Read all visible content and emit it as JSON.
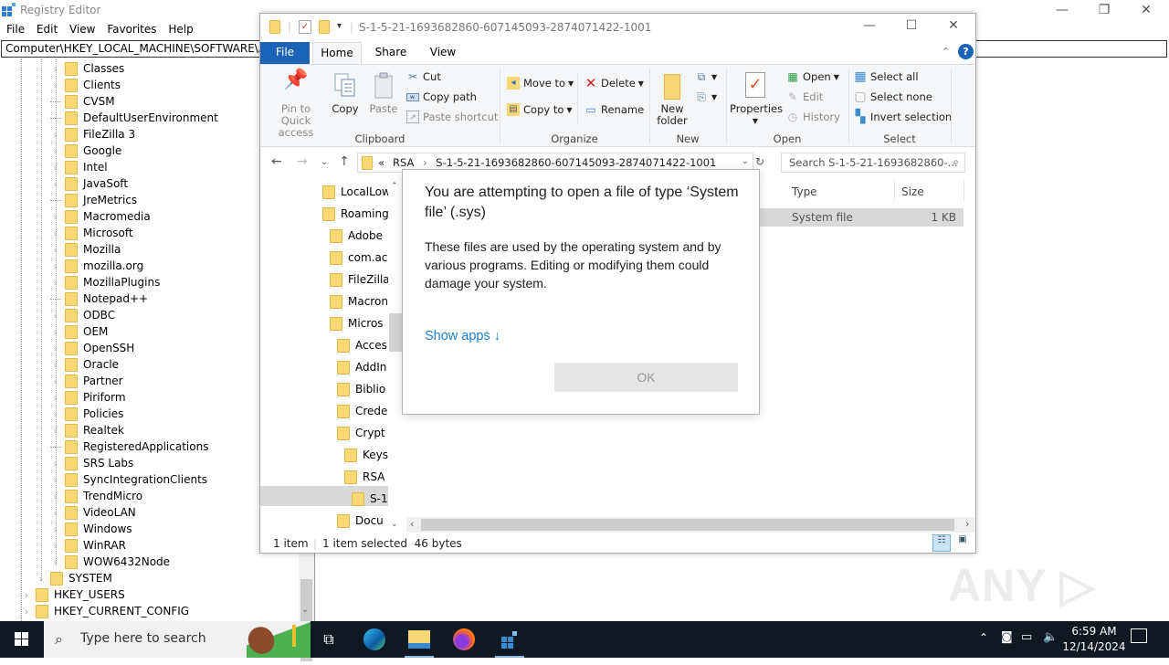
{
  "regedit": {
    "title": "Registry Editor",
    "menu": [
      "File",
      "Edit",
      "View",
      "Favorites",
      "Help"
    ],
    "address": "Computer\\HKEY_LOCAL_MACHINE\\SOFTWARE\\Adobe",
    "tree": [
      {
        "label": "Classes",
        "expandable": true
      },
      {
        "label": "Clients",
        "expandable": true
      },
      {
        "label": "CVSM",
        "expandable": false
      },
      {
        "label": "DefaultUserEnvironment",
        "expandable": false
      },
      {
        "label": "FileZilla 3",
        "expandable": true
      },
      {
        "label": "Google",
        "expandable": true
      },
      {
        "label": "Intel",
        "expandable": true
      },
      {
        "label": "JavaSoft",
        "expandable": true
      },
      {
        "label": "JreMetrics",
        "expandable": false
      },
      {
        "label": "Macromedia",
        "expandable": true
      },
      {
        "label": "Microsoft",
        "expandable": true
      },
      {
        "label": "Mozilla",
        "expandable": true
      },
      {
        "label": "mozilla.org",
        "expandable": true
      },
      {
        "label": "MozillaPlugins",
        "expandable": true
      },
      {
        "label": "Notepad++",
        "expandable": false
      },
      {
        "label": "ODBC",
        "expandable": true
      },
      {
        "label": "OEM",
        "expandable": true
      },
      {
        "label": "OpenSSH",
        "expandable": true
      },
      {
        "label": "Oracle",
        "expandable": true
      },
      {
        "label": "Partner",
        "expandable": true
      },
      {
        "label": "Piriform",
        "expandable": true
      },
      {
        "label": "Policies",
        "expandable": true
      },
      {
        "label": "Realtek",
        "expandable": true
      },
      {
        "label": "RegisteredApplications",
        "expandable": false
      },
      {
        "label": "SRS Labs",
        "expandable": true
      },
      {
        "label": "SyncIntegrationClients",
        "expandable": true
      },
      {
        "label": "TrendMicro",
        "expandable": true
      },
      {
        "label": "VideoLAN",
        "expandable": true
      },
      {
        "label": "Windows",
        "expandable": true
      },
      {
        "label": "WinRAR",
        "expandable": true
      },
      {
        "label": "WOW6432Node",
        "expandable": true
      }
    ],
    "tree_level2": [
      {
        "label": "SYSTEM"
      }
    ],
    "tree_root": [
      {
        "label": "HKEY_USERS"
      },
      {
        "label": "HKEY_CURRENT_CONFIG"
      }
    ]
  },
  "explorer": {
    "title_path": "S-1-5-21-1693682860-607145093-2874071422-1001",
    "tabs": {
      "file": "File",
      "home": "Home",
      "share": "Share",
      "view": "View"
    },
    "ribbon": {
      "clipboard": {
        "label": "Clipboard",
        "pin": "Pin to Quick access",
        "pin_line1": "Pin to Quick",
        "pin_line2": "access",
        "copy": "Copy",
        "paste": "Paste",
        "cut": "Cut",
        "copy_path": "Copy path",
        "paste_shortcut": "Paste shortcut"
      },
      "organize": {
        "label": "Organize",
        "move_to": "Move to",
        "copy_to": "Copy to",
        "delete": "Delete",
        "rename": "Rename"
      },
      "new": {
        "label": "New",
        "new_folder_line1": "New",
        "new_folder_line2": "folder"
      },
      "open": {
        "label": "Open",
        "properties": "Properties",
        "open": "Open",
        "edit": "Edit",
        "history": "History"
      },
      "select": {
        "label": "Select",
        "select_all": "Select all",
        "select_none": "Select none",
        "invert": "Invert selection"
      }
    },
    "address": {
      "overflow": "«",
      "crumbs": [
        "RSA",
        "S-1-5-21-1693682860-607145093-2874071422-1001"
      ]
    },
    "search_placeholder": "Search S-1-5-21-1693682860-...",
    "nav_pane": [
      {
        "label": "LocalLow",
        "indent": 0
      },
      {
        "label": "Roaming",
        "indent": 0
      },
      {
        "label": "Adobe",
        "indent": 1
      },
      {
        "label": "com.ac",
        "indent": 1
      },
      {
        "label": "FileZilla",
        "indent": 1
      },
      {
        "label": "Macron",
        "indent": 1
      },
      {
        "label": "Micros",
        "indent": 1
      },
      {
        "label": "Acces",
        "indent": 2
      },
      {
        "label": "AddIn",
        "indent": 2
      },
      {
        "label": "Biblio",
        "indent": 2
      },
      {
        "label": "Crede",
        "indent": 2
      },
      {
        "label": "Crypt",
        "indent": 2
      },
      {
        "label": "Keys",
        "indent": 3
      },
      {
        "label": "RSA",
        "indent": 3
      },
      {
        "label": "S-1",
        "indent": 4,
        "selected": true
      },
      {
        "label": "Docu",
        "indent": 2
      }
    ],
    "columns": {
      "type": "Type",
      "size": "Size"
    },
    "file": {
      "type": "System file",
      "size": "1 KB"
    },
    "status": {
      "count": "1 item",
      "selection": "1 item selected  46 bytes"
    }
  },
  "dialog": {
    "title": "You are attempting to open a file of type ‘System file’ (.sys)",
    "body": "These files are used by the operating system and by various programs. Editing or modifying them could damage your system.",
    "show_apps": "Show apps ↓",
    "ok": "OK"
  },
  "watermark": "ANY ▷ RUN",
  "taskbar": {
    "search_placeholder": "Type here to search",
    "time": "6:59 AM",
    "date": "12/14/2024",
    "apps": [
      "task-view",
      "edge",
      "file-explorer",
      "firefox",
      "registry-editor"
    ]
  },
  "colors": {
    "accent": "#1a63b6",
    "link": "#1a7fcf",
    "folder": "#f8d775",
    "taskbar": "#0f1923"
  }
}
